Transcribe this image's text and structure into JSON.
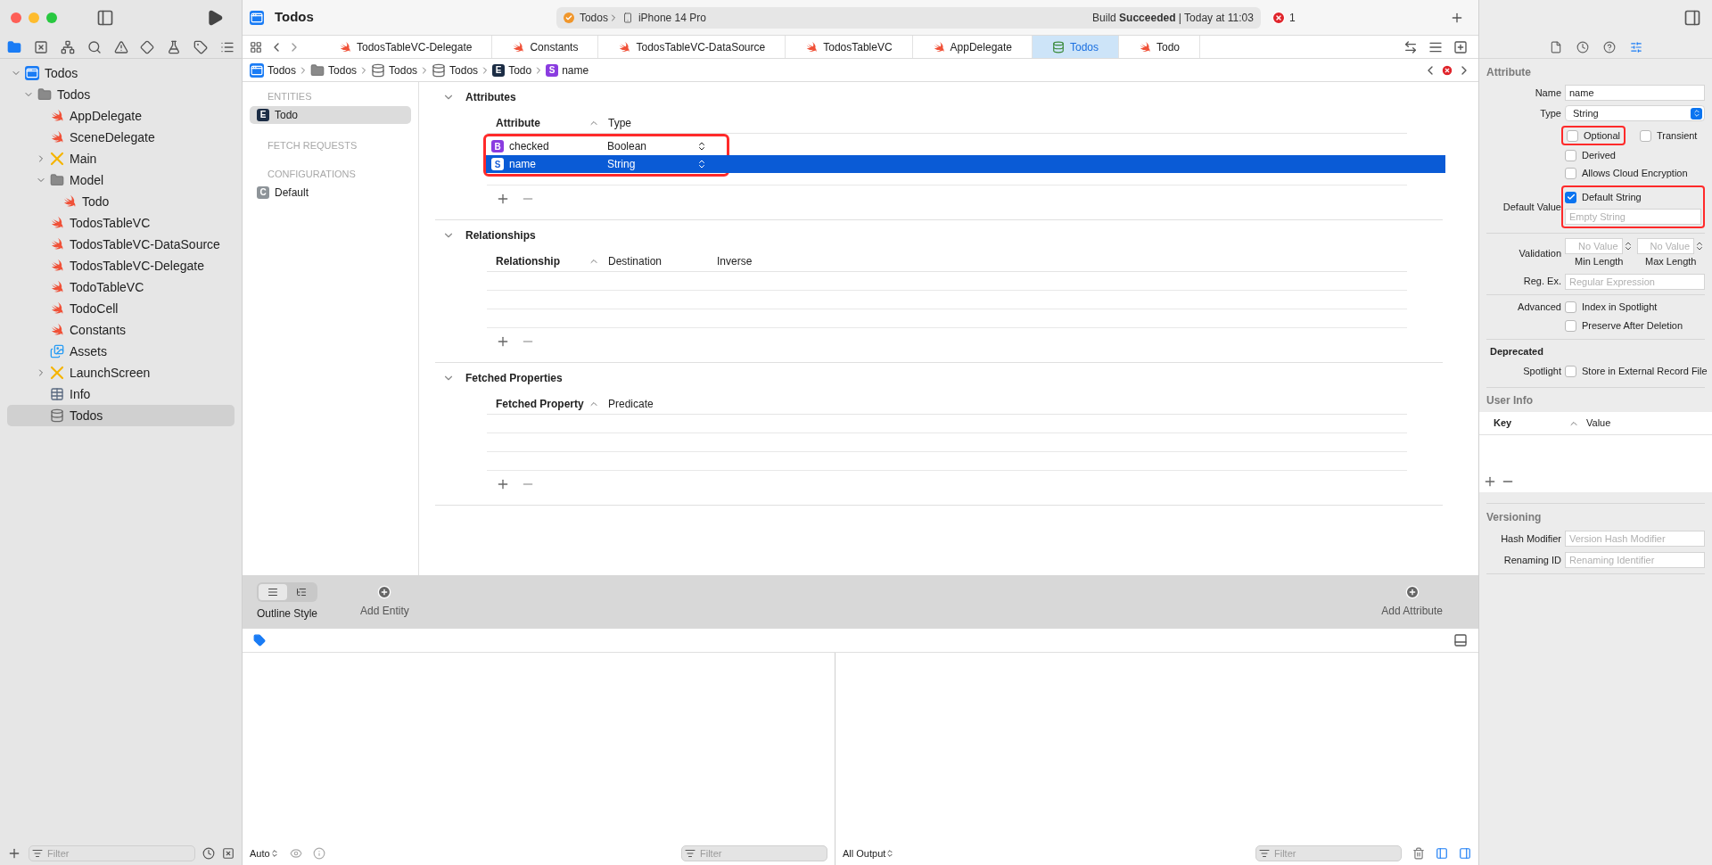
{
  "window": {
    "title": "Todos"
  },
  "scheme": {
    "target": "Todos",
    "device": "iPhone 14 Pro"
  },
  "build_status": "Build **Succeeded** | Today at 11:03",
  "error_count": "1",
  "navigator": {
    "tree": [
      {
        "label": "Todos",
        "kind": "project",
        "expanded": true,
        "selected": false,
        "children": [
          {
            "label": "Todos",
            "kind": "folder",
            "expanded": true,
            "selected": false,
            "children": [
              {
                "label": "AppDelegate",
                "kind": "swift",
                "selected": false
              },
              {
                "label": "SceneDelegate",
                "kind": "swift",
                "selected": false
              },
              {
                "label": "Main",
                "kind": "storyboard",
                "expanded": false,
                "selected": false
              },
              {
                "label": "Model",
                "kind": "folder",
                "expanded": true,
                "selected": false,
                "children": [
                  {
                    "label": "Todo",
                    "kind": "swift",
                    "selected": false
                  }
                ]
              },
              {
                "label": "TodosTableVC",
                "kind": "swift",
                "selected": false
              },
              {
                "label": "TodosTableVC-DataSource",
                "kind": "swift",
                "selected": false
              },
              {
                "label": "TodosTableVC-Delegate",
                "kind": "swift",
                "selected": false
              },
              {
                "label": "TodoTableVC",
                "kind": "swift",
                "selected": false
              },
              {
                "label": "TodoCell",
                "kind": "swift",
                "selected": false
              },
              {
                "label": "Constants",
                "kind": "swift",
                "selected": false
              },
              {
                "label": "Assets",
                "kind": "assets",
                "selected": false
              },
              {
                "label": "LaunchScreen",
                "kind": "storyboard",
                "expanded": false,
                "selected": false
              },
              {
                "label": "Info",
                "kind": "plist",
                "selected": false
              },
              {
                "label": "Todos",
                "kind": "datamodel",
                "selected": true
              }
            ]
          }
        ]
      }
    ],
    "filter_placeholder": "Filter"
  },
  "tabs": [
    {
      "label": "TodosTableVC-Delegate",
      "kind": "swift",
      "selected": false
    },
    {
      "label": "Constants",
      "kind": "swift",
      "selected": false
    },
    {
      "label": "TodosTableVC-DataSource",
      "kind": "swift",
      "selected": false
    },
    {
      "label": "TodosTableVC",
      "kind": "swift",
      "selected": false
    },
    {
      "label": "AppDelegate",
      "kind": "swift",
      "selected": false
    },
    {
      "label": "Todos",
      "kind": "datamodel",
      "selected": true
    },
    {
      "label": "Todo",
      "kind": "swift",
      "selected": false
    }
  ],
  "breadcrumb": [
    {
      "label": "Todos",
      "kind": "project"
    },
    {
      "label": "Todos",
      "kind": "folder"
    },
    {
      "label": "Todos",
      "kind": "model-group"
    },
    {
      "label": "Todos",
      "kind": "datamodel"
    },
    {
      "label": "Todo",
      "kind": "badge",
      "badge": "E",
      "color": "#1c2d45"
    },
    {
      "label": "name",
      "kind": "badge",
      "badge": "S",
      "color": "#8a3ce0"
    }
  ],
  "entity_list": [
    {
      "heading": "ENTITIES",
      "items": [
        {
          "label": "Todo",
          "badge": "E",
          "color": "#1c2d45",
          "selected": true
        }
      ]
    },
    {
      "heading": "FETCH REQUESTS"
    },
    {
      "heading": "CONFIGURATIONS",
      "items": [
        {
          "label": "Default",
          "badge": "C",
          "color": "#8e9499",
          "selected": false
        }
      ]
    }
  ],
  "editor_sections": [
    {
      "title": "Attributes",
      "expanded": true,
      "highlighted": true,
      "columns": [
        "Attribute",
        "Type"
      ],
      "rows": [
        {
          "badge": "B",
          "name": "checked",
          "type": "Boolean",
          "color": "#8a3ce0",
          "selected": false
        },
        {
          "badge": "S",
          "name": "name",
          "type": "String",
          "selected": true
        }
      ]
    },
    {
      "title": "Relationships",
      "expanded": true,
      "columns": [
        "Relationship",
        "Destination",
        "Inverse"
      ]
    },
    {
      "title": "Fetched Properties",
      "expanded": true,
      "columns": [
        "Fetched Property",
        "Predicate"
      ]
    }
  ],
  "editor_toolbar": {
    "segments": [
      {
        "kind": "table",
        "selected": true
      },
      {
        "kind": "graph",
        "selected": false
      }
    ],
    "style_label": "Outline Style",
    "add_entity": "Add Entity",
    "add_attribute": "Add Attribute"
  },
  "debug": {
    "variables_scope": "Auto",
    "variables_filter_placeholder": "Filter",
    "output_scope": "All Output",
    "output_filter_placeholder": "Filter"
  },
  "inspector": {
    "tabs": [
      {
        "kind": "file",
        "selected": false
      },
      {
        "kind": "history",
        "selected": false
      },
      {
        "kind": "help",
        "selected": false
      },
      {
        "kind": "attributes",
        "selected": true
      }
    ],
    "title": "Attribute",
    "name": {
      "label": "Name",
      "value": "name"
    },
    "type": {
      "label": "Type",
      "value": "String"
    },
    "options": [
      {
        "label": "Optional",
        "checked": false,
        "highlighted": true
      },
      {
        "label": "Transient",
        "checked": false
      },
      {
        "label": "Derived",
        "checked": false
      },
      {
        "label": "Allows Cloud Encryption",
        "checked": false
      }
    ],
    "default_value": {
      "label": "Default Value",
      "checkbox": "Default String",
      "checked": true,
      "placeholder": "Empty String",
      "highlighted": true
    },
    "validation": {
      "label": "Validation",
      "min_placeholder": "No Value",
      "max_placeholder": "No Value",
      "min_caption": "Min Length",
      "max_caption": "Max Length"
    },
    "regex": {
      "label": "Reg. Ex.",
      "placeholder": "Regular Expression"
    },
    "advanced": {
      "label": "Advanced",
      "options": [
        {
          "label": "Index in Spotlight",
          "checked": false
        },
        {
          "label": "Preserve After Deletion",
          "checked": false
        }
      ]
    },
    "deprecated": {
      "heading": "Deprecated",
      "label": "Spotlight",
      "option": {
        "label": "Store in External Record File",
        "checked": false
      }
    },
    "user_info": {
      "title": "User Info",
      "columns": [
        "Key",
        "Value"
      ]
    },
    "versioning": {
      "title": "Versioning",
      "fields": [
        {
          "label": "Hash Modifier",
          "placeholder": "Version Hash Modifier"
        },
        {
          "label": "Renaming ID",
          "placeholder": "Renaming Identifier"
        }
      ]
    }
  }
}
